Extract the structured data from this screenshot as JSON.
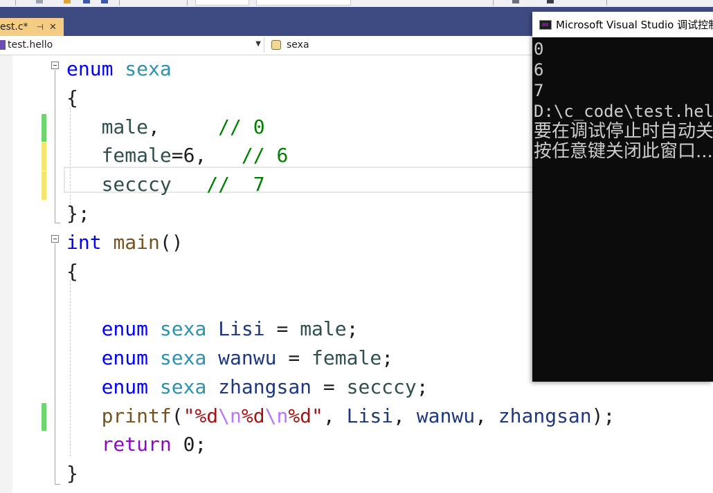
{
  "editor_tab": {
    "title": "est.c*",
    "pin_icon": "pin-icon",
    "close_icon": "close-icon"
  },
  "navbar": {
    "scope": "test.hello",
    "symbol": "sexa"
  },
  "code": [
    [
      {
        "t": "enum",
        "c": "kw"
      },
      {
        "t": " "
      },
      {
        "t": "sexa",
        "c": "ty"
      }
    ],
    [
      {
        "t": "{",
        "c": "pl"
      }
    ],
    [
      {
        "t": "   male",
        "c": "en"
      },
      {
        "t": ",     "
      },
      {
        "t": "// 0",
        "c": "cm"
      }
    ],
    [
      {
        "t": "   female",
        "c": "en"
      },
      {
        "t": "=6,   "
      },
      {
        "t": "// 6",
        "c": "cm"
      }
    ],
    [
      {
        "t": "   secccy",
        "c": "en"
      },
      {
        "t": "   "
      },
      {
        "t": "//  7",
        "c": "cm"
      }
    ],
    [
      {
        "t": "};",
        "c": "pl"
      }
    ],
    [
      {
        "t": "int",
        "c": "kw"
      },
      {
        "t": " "
      },
      {
        "t": "main",
        "c": "fn"
      },
      {
        "t": "()"
      }
    ],
    [
      {
        "t": "{",
        "c": "pl"
      }
    ],
    [],
    [
      {
        "t": "   enum",
        "c": "kw"
      },
      {
        "t": " "
      },
      {
        "t": "sexa",
        "c": "ty"
      },
      {
        "t": " "
      },
      {
        "t": "Lisi",
        "c": "vr"
      },
      {
        "t": " = "
      },
      {
        "t": "male",
        "c": "en"
      },
      {
        "t": ";"
      }
    ],
    [
      {
        "t": "   enum",
        "c": "kw"
      },
      {
        "t": " "
      },
      {
        "t": "sexa",
        "c": "ty"
      },
      {
        "t": " "
      },
      {
        "t": "wanwu",
        "c": "vr"
      },
      {
        "t": " = "
      },
      {
        "t": "female",
        "c": "en"
      },
      {
        "t": ";"
      }
    ],
    [
      {
        "t": "   enum",
        "c": "kw"
      },
      {
        "t": " "
      },
      {
        "t": "sexa",
        "c": "ty"
      },
      {
        "t": " "
      },
      {
        "t": "zhangsan",
        "c": "vr"
      },
      {
        "t": " = "
      },
      {
        "t": "secccy",
        "c": "en"
      },
      {
        "t": ";"
      }
    ],
    [
      {
        "t": "   printf",
        "c": "fn"
      },
      {
        "t": "("
      },
      {
        "t": "\"%d",
        "c": "st"
      },
      {
        "t": "\\n",
        "c": "es"
      },
      {
        "t": "%d",
        "c": "st"
      },
      {
        "t": "\\n",
        "c": "es"
      },
      {
        "t": "%d\"",
        "c": "st"
      },
      {
        "t": ", "
      },
      {
        "t": "Lisi",
        "c": "vr"
      },
      {
        "t": ", "
      },
      {
        "t": "wanwu",
        "c": "vr"
      },
      {
        "t": ", "
      },
      {
        "t": "zhangsan",
        "c": "vr"
      },
      {
        "t": ");"
      }
    ],
    [
      {
        "t": "   return",
        "c": "kwp"
      },
      {
        "t": " 0;"
      }
    ],
    [
      {
        "t": "}",
        "c": "pl"
      }
    ]
  ],
  "change_markers": [
    {
      "line": 2,
      "color": "#6ed46e"
    },
    {
      "line": 3,
      "color": "#f4e66b"
    },
    {
      "line": 4,
      "color": "#f4e66b"
    },
    {
      "line": 12,
      "color": "#6ed46e"
    }
  ],
  "console": {
    "title": "Microsoft Visual Studio 调试控制台",
    "lines": [
      "0",
      "6",
      "7",
      "D:\\c_code\\test.hello\\Debug\\test.hello.exe",
      "要在调试停止时自动关闭控制台",
      "按任意键关闭此窗口..."
    ]
  }
}
